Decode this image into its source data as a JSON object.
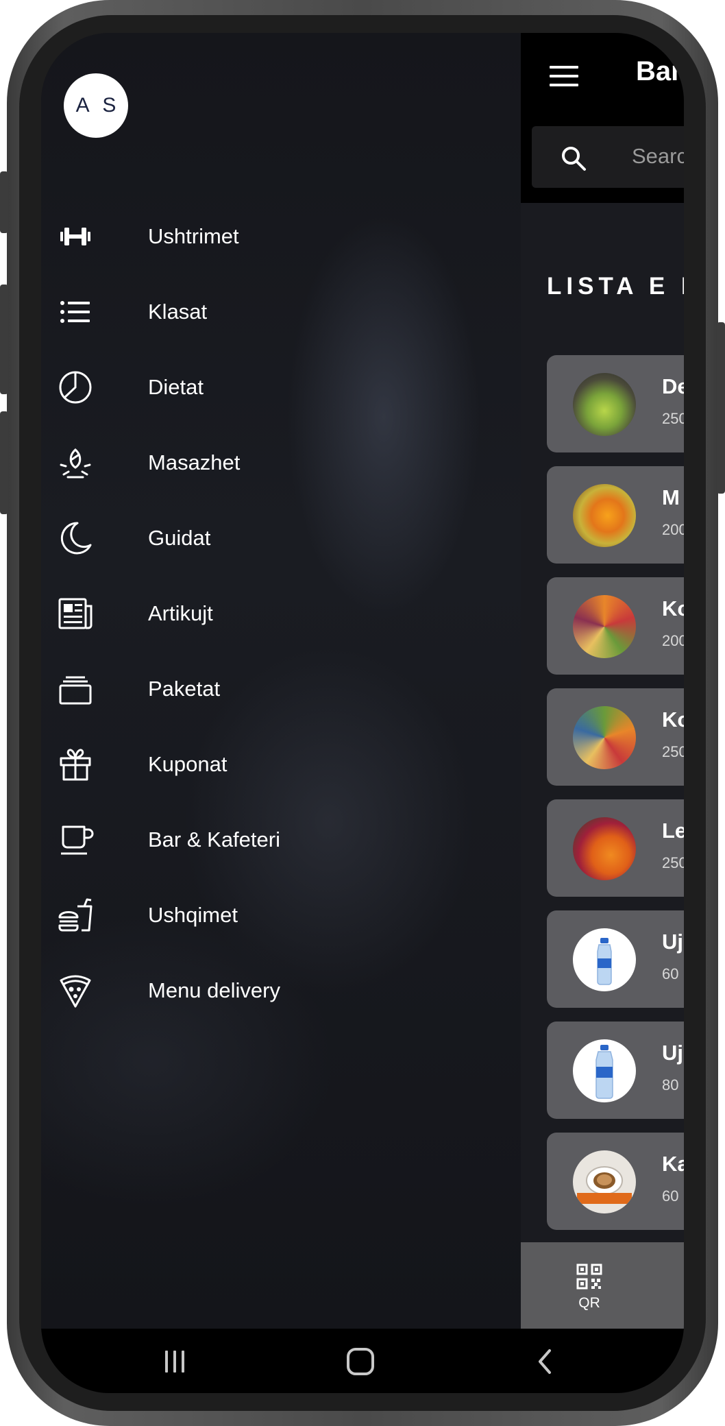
{
  "drawer": {
    "avatar_initials": "A S",
    "items": [
      {
        "label": "Ushtrimet",
        "icon": "dumbbell-icon"
      },
      {
        "label": "Klasat",
        "icon": "list-icon"
      },
      {
        "label": "Dietat",
        "icon": "pie-chart-icon"
      },
      {
        "label": "Masazhet",
        "icon": "spa-icon"
      },
      {
        "label": "Guidat",
        "icon": "moon-icon"
      },
      {
        "label": "Artikujt",
        "icon": "newspaper-icon"
      },
      {
        "label": "Paketat",
        "icon": "stacked-cards-icon"
      },
      {
        "label": "Kuponat",
        "icon": "gift-icon"
      },
      {
        "label": "Bar & Kafeteri",
        "icon": "coffee-cup-icon"
      },
      {
        "label": "Ushqimet",
        "icon": "fastfood-icon"
      },
      {
        "label": "Menu delivery",
        "icon": "pizza-slice-icon"
      }
    ]
  },
  "main": {
    "title": "Bar",
    "search_placeholder": "Search",
    "list_title": "LISTA E P",
    "products": [
      {
        "name": "De",
        "price": "250",
        "image": "green-smoothie"
      },
      {
        "name": "M",
        "price": "200",
        "image": "fruit-juice"
      },
      {
        "name": "Ko",
        "price": "200",
        "image": "fruit-bowl"
      },
      {
        "name": "Ko",
        "price": "250",
        "image": "fruit-bowl"
      },
      {
        "name": "Le",
        "price": "250",
        "image": "orange-juice"
      },
      {
        "name": "Uj",
        "price": "60",
        "image": "water-bottle"
      },
      {
        "name": "Uj",
        "price": "80",
        "image": "water-bottle"
      },
      {
        "name": "Ka",
        "price": "60",
        "image": "espresso-cup"
      }
    ],
    "bottom_tab_label": "QR"
  },
  "colors": {
    "drawer_bg": "#15161b",
    "card_bg": "#5c5c60",
    "appbar_bg": "#000000",
    "bottom_tab_bg": "#5b5b5d",
    "text": "#ffffff"
  }
}
